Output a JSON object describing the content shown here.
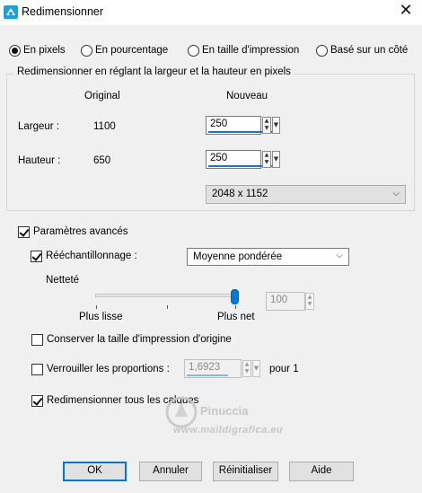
{
  "window": {
    "title": "Redimensionner",
    "close_glyph": "✕"
  },
  "mode_radios": [
    {
      "label": "En pixels",
      "selected": true
    },
    {
      "label": "En pourcentage",
      "selected": false
    },
    {
      "label": "En taille d'impression",
      "selected": false
    },
    {
      "label": "Basé sur un côté",
      "selected": false
    }
  ],
  "group": {
    "title": "Redimensionner en réglant la largeur et la hauteur en pixels",
    "col_original": "Original",
    "col_nouveau": "Nouveau",
    "width": {
      "label": "Largeur :",
      "original": "1100",
      "value": "250"
    },
    "height": {
      "label": "Hauteur :",
      "original": "650",
      "value": "250"
    },
    "preset": "2048 x 1152"
  },
  "advanced": {
    "label": "Paramètres avancés",
    "checked": true,
    "resample": {
      "label": "Rééchantillonnage :",
      "checked": true,
      "method": "Moyenne pondérée"
    },
    "sharpness": {
      "label": "Netteté",
      "min_label": "Plus lisse",
      "max_label": "Plus net",
      "value": "100",
      "level": 1.0
    },
    "keep_print_size": {
      "label": "Conserver la taille d'impression d'origine",
      "checked": false
    },
    "lock_ratio": {
      "label": "Verrouiller les proportions :",
      "checked": false,
      "value": "1,6923",
      "suffix": "pour 1"
    },
    "resize_all_layers": {
      "label": "Redimensionner tous les calques",
      "checked": true
    }
  },
  "buttons": {
    "ok": "OK",
    "cancel": "Annuler",
    "reset": "Réinitialiser",
    "help": "Aide"
  },
  "watermark": {
    "name": "Pinuccia",
    "url": "www.maildigrafica.eu"
  },
  "colors": {
    "accent": "#0078d7",
    "slider_thumb": "#007ad9",
    "window_bg": "#f0f0f0"
  }
}
